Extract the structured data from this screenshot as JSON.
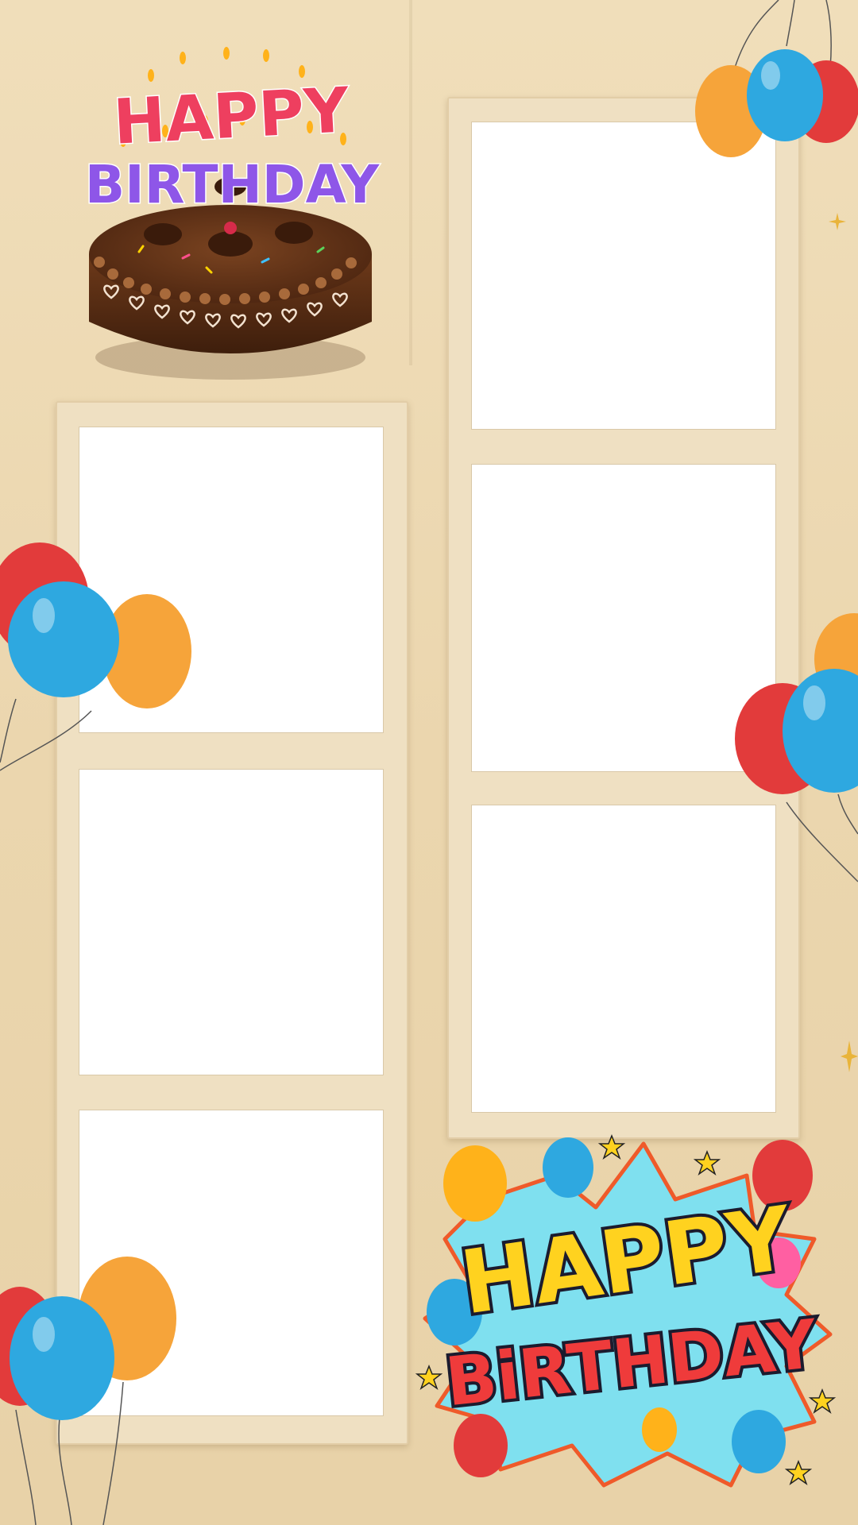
{
  "cake_title": {
    "line1": "HAPPY",
    "line2": "BIRTHDAY"
  },
  "badge": {
    "line1": "HAPPY",
    "line2": "BiRTHDAY"
  },
  "photo_strips": [
    {
      "slots": 3
    },
    {
      "slots": 3
    }
  ],
  "colors": {
    "background": "#ebd6ae",
    "strip": "#efe0c2",
    "slot": "#ffffff",
    "balloon_red": "#e23b3b",
    "balloon_blue": "#2ea8e0",
    "balloon_orange": "#f6a43a",
    "badge_yellow": "#ffd21f",
    "badge_red": "#ef3b3b",
    "badge_burst": "#7fe0ef"
  }
}
